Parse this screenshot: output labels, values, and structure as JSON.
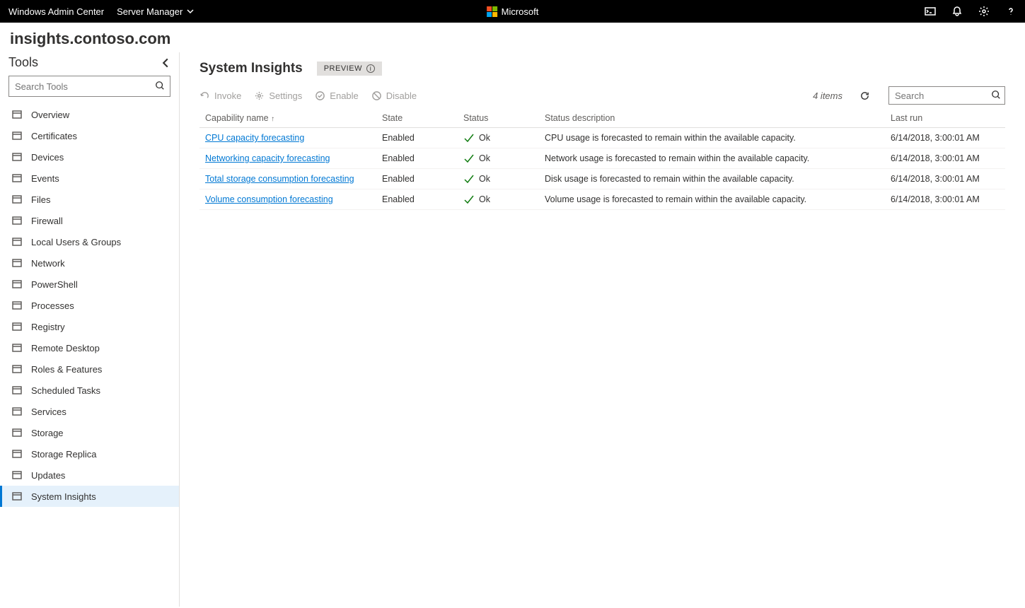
{
  "topbar": {
    "app_name": "Windows Admin Center",
    "context_label": "Server Manager",
    "ms_label": "Microsoft"
  },
  "connection": {
    "host": "insights.contoso.com"
  },
  "sidebar": {
    "title": "Tools",
    "search_placeholder": "Search Tools",
    "items": [
      {
        "label": "Overview",
        "icon": "overview-icon"
      },
      {
        "label": "Certificates",
        "icon": "certificates-icon"
      },
      {
        "label": "Devices",
        "icon": "devices-icon"
      },
      {
        "label": "Events",
        "icon": "events-icon"
      },
      {
        "label": "Files",
        "icon": "files-icon"
      },
      {
        "label": "Firewall",
        "icon": "firewall-icon"
      },
      {
        "label": "Local Users & Groups",
        "icon": "users-icon"
      },
      {
        "label": "Network",
        "icon": "network-icon"
      },
      {
        "label": "PowerShell",
        "icon": "powershell-icon"
      },
      {
        "label": "Processes",
        "icon": "processes-icon"
      },
      {
        "label": "Registry",
        "icon": "registry-icon"
      },
      {
        "label": "Remote Desktop",
        "icon": "remote-desktop-icon"
      },
      {
        "label": "Roles & Features",
        "icon": "roles-icon"
      },
      {
        "label": "Scheduled Tasks",
        "icon": "tasks-icon"
      },
      {
        "label": "Services",
        "icon": "services-icon"
      },
      {
        "label": "Storage",
        "icon": "storage-icon"
      },
      {
        "label": "Storage Replica",
        "icon": "replica-icon"
      },
      {
        "label": "Updates",
        "icon": "updates-icon"
      },
      {
        "label": "System Insights",
        "icon": "insights-icon",
        "active": true
      }
    ]
  },
  "page": {
    "title": "System Insights",
    "preview_label": "PREVIEW"
  },
  "toolbar": {
    "invoke": "Invoke",
    "settings": "Settings",
    "enable": "Enable",
    "disable": "Disable",
    "item_count": "4 items",
    "search_placeholder": "Search"
  },
  "table": {
    "columns": {
      "name": "Capability name",
      "state": "State",
      "status": "Status",
      "desc": "Status description",
      "last_run": "Last run"
    },
    "rows": [
      {
        "name": "CPU capacity forecasting",
        "state": "Enabled",
        "status": "Ok",
        "desc": "CPU usage is forecasted to remain within the available capacity.",
        "last_run": "6/14/2018, 3:00:01 AM"
      },
      {
        "name": "Networking capacity forecasting",
        "state": "Enabled",
        "status": "Ok",
        "desc": "Network usage is forecasted to remain within the available capacity.",
        "last_run": "6/14/2018, 3:00:01 AM"
      },
      {
        "name": "Total storage consumption forecasting",
        "state": "Enabled",
        "status": "Ok",
        "desc": "Disk usage is forecasted to remain within the available capacity.",
        "last_run": "6/14/2018, 3:00:01 AM"
      },
      {
        "name": "Volume consumption forecasting",
        "state": "Enabled",
        "status": "Ok",
        "desc": "Volume usage is forecasted to remain within the available capacity.",
        "last_run": "6/14/2018, 3:00:01 AM"
      }
    ]
  }
}
